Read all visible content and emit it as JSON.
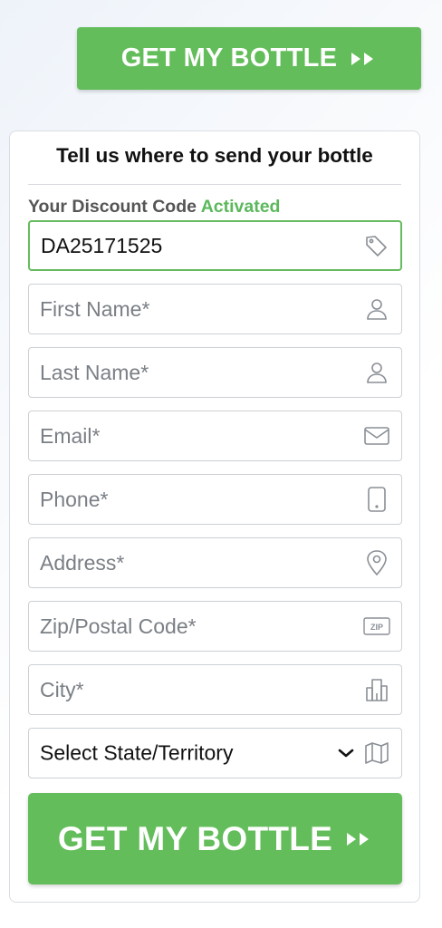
{
  "top_cta": {
    "label": "GET MY BOTTLE",
    "icon": "double-chevron-right-icon"
  },
  "form": {
    "title": "Tell us where to send your bottle",
    "discount": {
      "label": "Your Discount Code",
      "status": "Activated",
      "code": "DA25171525",
      "icon": "tag-icon"
    },
    "fields": {
      "first_name": {
        "placeholder": "First Name*",
        "icon": "user-icon"
      },
      "last_name": {
        "placeholder": "Last Name*",
        "icon": "user-icon"
      },
      "email": {
        "placeholder": "Email*",
        "icon": "envelope-icon"
      },
      "phone": {
        "placeholder": "Phone*",
        "icon": "mobile-phone-icon"
      },
      "address": {
        "placeholder": "Address*",
        "icon": "location-pin-icon"
      },
      "zip": {
        "placeholder": "Zip/Postal Code*",
        "icon": "zip-icon",
        "icon_text": "ZIP"
      },
      "city": {
        "placeholder": "City*",
        "icon": "buildings-icon"
      },
      "state": {
        "selected": "Select State/Territory",
        "icon": "map-icon"
      }
    },
    "submit": {
      "label": "GET MY BOTTLE",
      "icon": "double-chevron-right-icon"
    }
  },
  "colors": {
    "accent_green": "#63bd5a",
    "activated_green": "#5cb85c",
    "border": "#ccd0d5"
  }
}
